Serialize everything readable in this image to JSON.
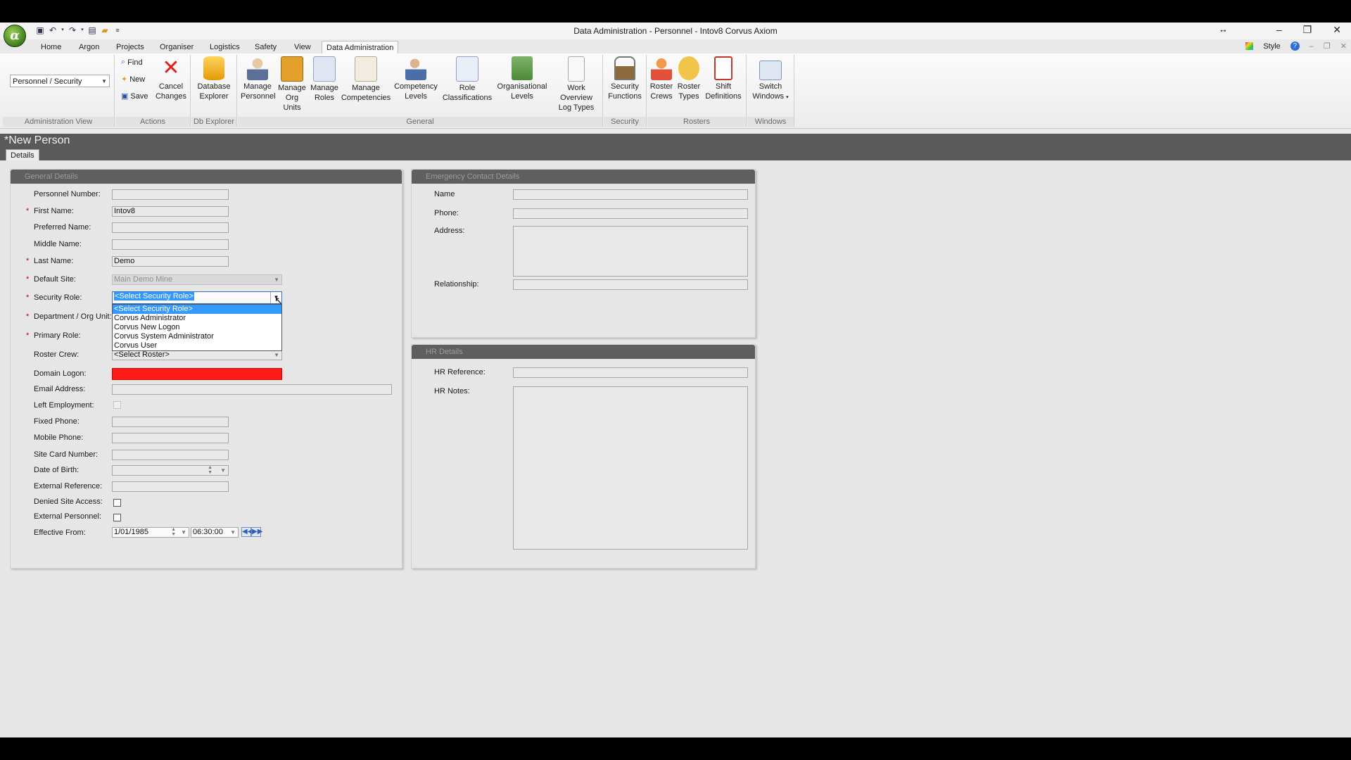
{
  "window": {
    "title": "Data Administration - Personnel - Intov8 Corvus Axiom",
    "logo_letter": "α"
  },
  "menu_tabs": [
    "Home",
    "Argon",
    "Projects",
    "Organiser",
    "Logistics",
    "Safety",
    "View",
    "Data Administration"
  ],
  "style_label": "Style",
  "ribbon": {
    "admin_view_value": "Personnel / Security",
    "group_labels": {
      "admin_view": "Administration View",
      "actions": "Actions",
      "db_explorer": "Db Explorer",
      "general": "General",
      "security": "Security",
      "rosters": "Rosters",
      "windows": "Windows"
    },
    "actions": {
      "find": "Find",
      "new": "New",
      "save": "Save",
      "cancel_line1": "Cancel",
      "cancel_line2": "Changes"
    },
    "db_explorer": {
      "line1": "Database",
      "line2": "Explorer"
    },
    "general": [
      {
        "l1": "Manage",
        "l2": "Personnel"
      },
      {
        "l1": "Manage",
        "l2": "Org Units"
      },
      {
        "l1": "Manage",
        "l2": "Roles"
      },
      {
        "l1": "Manage",
        "l2": "Competencies"
      },
      {
        "l1": "Competency",
        "l2": "Levels"
      },
      {
        "l1": "Role",
        "l2": "Classifications"
      },
      {
        "l1": "Organisational",
        "l2": "Levels"
      },
      {
        "l1": "Work Overview",
        "l2": "Log Types"
      }
    ],
    "security": {
      "l1": "Security",
      "l2": "Functions"
    },
    "rosters": [
      {
        "l1": "Roster",
        "l2": "Crews"
      },
      {
        "l1": "Roster",
        "l2": "Types"
      },
      {
        "l1": "Shift",
        "l2": "Definitions"
      }
    ],
    "windows": {
      "l1": "Switch",
      "l2": "Windows"
    }
  },
  "document": {
    "title": "*New Person",
    "tab": "Details"
  },
  "general_details": {
    "header": "General Details",
    "labels": {
      "personnel_number": "Personnel Number:",
      "first_name": "First Name:",
      "preferred_name": "Preferred Name:",
      "middle_name": "Middle Name:",
      "last_name": "Last Name:",
      "default_site": "Default Site:",
      "security_role": "Security Role:",
      "department": "Department / Org Unit:",
      "primary_role": "Primary Role:",
      "roster_crew": "Roster Crew:",
      "domain_logon": "Domain Logon:",
      "email": "Email Address:",
      "left_employment": "Left Employment:",
      "fixed_phone": "Fixed Phone:",
      "mobile_phone": "Mobile Phone:",
      "site_card": "Site Card Number:",
      "dob": "Date of Birth:",
      "external_ref": "External Reference:",
      "denied_site": "Denied Site Access:",
      "external_personnel": "External Personnel:",
      "effective_from": "Effective From:"
    },
    "values": {
      "first_name": "Intov8",
      "last_name": "Demo",
      "default_site": "Main Demo Mine",
      "security_role": "<Select Security Role>",
      "roster_crew": "<Select Roster>",
      "effective_date": "1/01/1985",
      "effective_time": "06:30:00"
    },
    "required_marker": "*",
    "security_role_options": [
      "<Select Security Role>",
      "Corvus Administrator",
      "Corvus New Logon",
      "Corvus System Administrator",
      "Corvus User"
    ],
    "domain_logon_error_color": "#ff1a1a"
  },
  "emergency_contact": {
    "header": "Emergency Contact Details",
    "labels": {
      "name": "Name",
      "phone": "Phone:",
      "address": "Address:",
      "relationship": "Relationship:"
    }
  },
  "hr_details": {
    "header": "HR Details",
    "labels": {
      "reference": "HR Reference:",
      "notes": "HR Notes:"
    }
  }
}
